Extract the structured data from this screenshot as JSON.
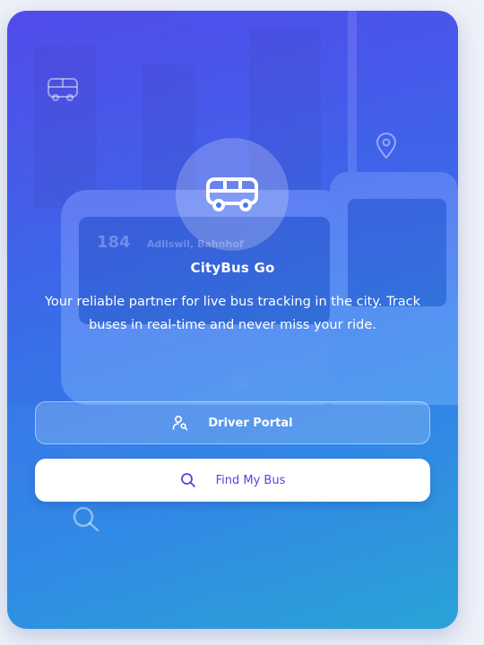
{
  "app": {
    "name": "CityBus Go",
    "description": "Your reliable partner for live bus tracking in the city. Track buses in real-time and never miss your ride."
  },
  "background": {
    "bus_number": "184",
    "bus_destination": "Adliswil, Bahnhof"
  },
  "icons": {
    "corner_top_left": "bus-icon",
    "corner_top_right": "map-pin-icon",
    "corner_bottom_left": "search-icon",
    "logo": "bus-icon"
  },
  "actions": {
    "driver_portal": {
      "label": "Driver Portal",
      "icon": "user-key-icon"
    },
    "find_my_bus": {
      "label": "Find My Bus",
      "icon": "search-icon"
    }
  },
  "colors": {
    "gradient_start": "#5b4df0",
    "gradient_mid": "#3f6df2",
    "gradient_end": "#25b3d6",
    "accent_text": "#5b3fe0",
    "white": "#ffffff"
  }
}
